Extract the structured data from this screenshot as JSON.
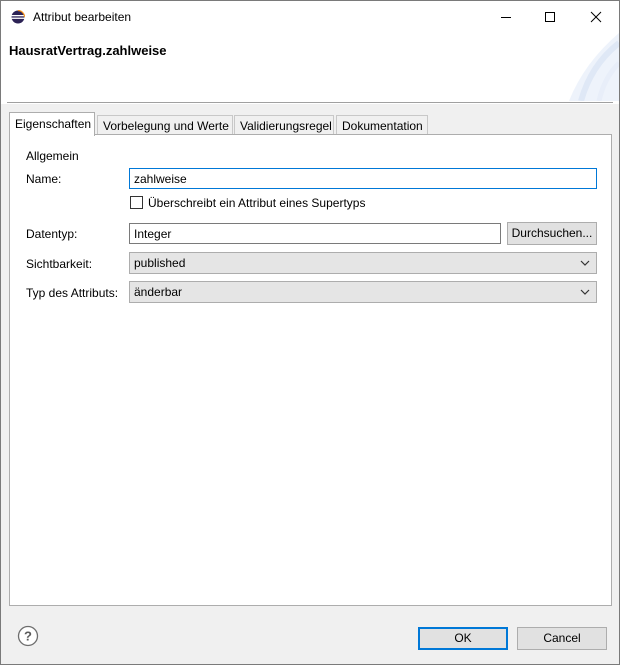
{
  "window": {
    "title": "Attribut bearbeiten"
  },
  "header": {
    "title": "HausratVertrag.zahlweise"
  },
  "tabs": [
    {
      "label": "Eigenschaften",
      "active": true
    },
    {
      "label": "Vorbelegung und Werte",
      "active": false
    },
    {
      "label": "Validierungsregel",
      "active": false
    },
    {
      "label": "Dokumentation",
      "active": false
    }
  ],
  "form": {
    "section": "Allgemein",
    "name_label": "Name:",
    "name_value": "zahlweise",
    "override_checkbox_label": "Überschreibt ein Attribut eines Supertyps",
    "override_checked": false,
    "datatype_label": "Datentyp:",
    "datatype_value": "Integer",
    "browse_label": "Durchsuchen...",
    "visibility_label": "Sichtbarkeit:",
    "visibility_value": "published",
    "attrtype_label": "Typ des Attributs:",
    "attrtype_value": "änderbar"
  },
  "footer": {
    "help_symbol": "?",
    "ok_label": "OK",
    "cancel_label": "Cancel"
  },
  "colors": {
    "accent": "#0078d7",
    "panel_bg": "#f0f0f0",
    "combo_bg": "#e5e5e5"
  }
}
